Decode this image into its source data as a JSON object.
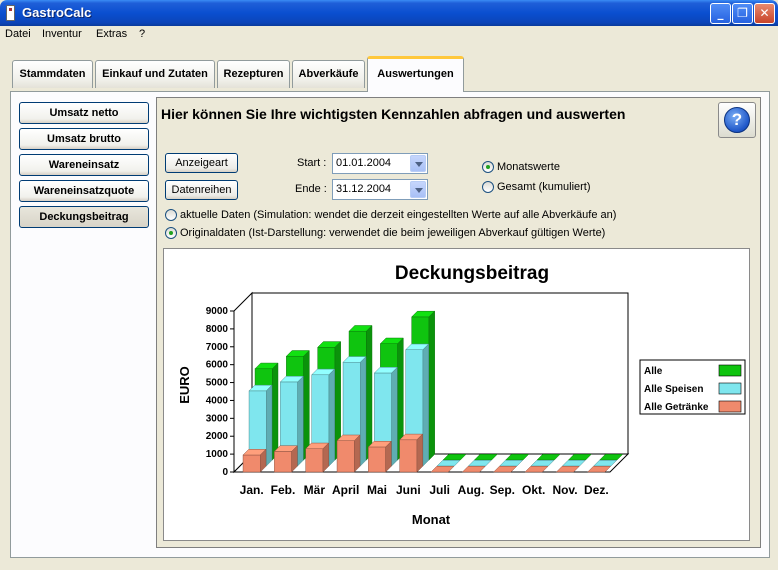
{
  "window": {
    "title": "GastroCalc"
  },
  "menu": [
    "Datei",
    "Inventur",
    "Extras",
    "?"
  ],
  "tabs": [
    {
      "label": "Stammdaten"
    },
    {
      "label": "Einkauf und Zutaten"
    },
    {
      "label": "Rezepturen"
    },
    {
      "label": "Abverkäufe"
    },
    {
      "label": "Auswertungen"
    }
  ],
  "sidebar": [
    {
      "label": "Umsatz netto"
    },
    {
      "label": "Umsatz brutto"
    },
    {
      "label": "Wareneinsatz"
    },
    {
      "label": "Wareneinsatzquote"
    },
    {
      "label": "Deckungsbeitrag"
    }
  ],
  "main": {
    "headline": "Hier können Sie Ihre wichtigsten Kennzahlen abfragen und auswerten",
    "btn_anzeigeart": "Anzeigeart",
    "btn_datenreihen": "Datenreihen",
    "start_label": "Start :",
    "start_value": "01.01.2004",
    "ende_label": "Ende :",
    "ende_value": "31.12.2004",
    "radio_monat": "Monatswerte",
    "radio_gesamt": "Gesamt (kumuliert)",
    "radio_aktuell": "aktuelle Daten (Simulation: wendet die derzeit eingestellten Werte auf alle Abverkäufe an)",
    "radio_original": "Originaldaten (Ist-Darstellung: verwendet die beim jeweiligen Abverkauf gültigen Werte)"
  },
  "colors": {
    "alle": "#0fc40f",
    "speisen": "#7fe6ee",
    "getraenke": "#f08a6c"
  },
  "chart_data": {
    "type": "bar",
    "title": "Deckungsbeitrag",
    "ylabel": "EURO",
    "xlabel": "Monat",
    "ylim": [
      0,
      9000
    ],
    "yticks": [
      "0",
      "1000",
      "2000",
      "3000",
      "4000",
      "5000",
      "6000",
      "7000",
      "8000",
      "9000"
    ],
    "categories": [
      "Jan.",
      "Feb.",
      "Mär",
      "April",
      "Mai",
      "Juni",
      "Juli",
      "Aug.",
      "Sep.",
      "Okt.",
      "Nov.",
      "Dez."
    ],
    "series": [
      {
        "name": "Alle",
        "values": [
          5100,
          5800,
          6300,
          7200,
          6500,
          8000,
          0,
          0,
          0,
          0,
          0,
          0
        ]
      },
      {
        "name": "Alle Speisen",
        "values": [
          4200,
          4700,
          5100,
          5800,
          5200,
          6500,
          0,
          0,
          0,
          0,
          0,
          0
        ]
      },
      {
        "name": "Alle Getränke",
        "values": [
          950,
          1150,
          1300,
          1750,
          1400,
          1800,
          0,
          0,
          0,
          0,
          0,
          0
        ]
      }
    ],
    "legend": "right"
  }
}
